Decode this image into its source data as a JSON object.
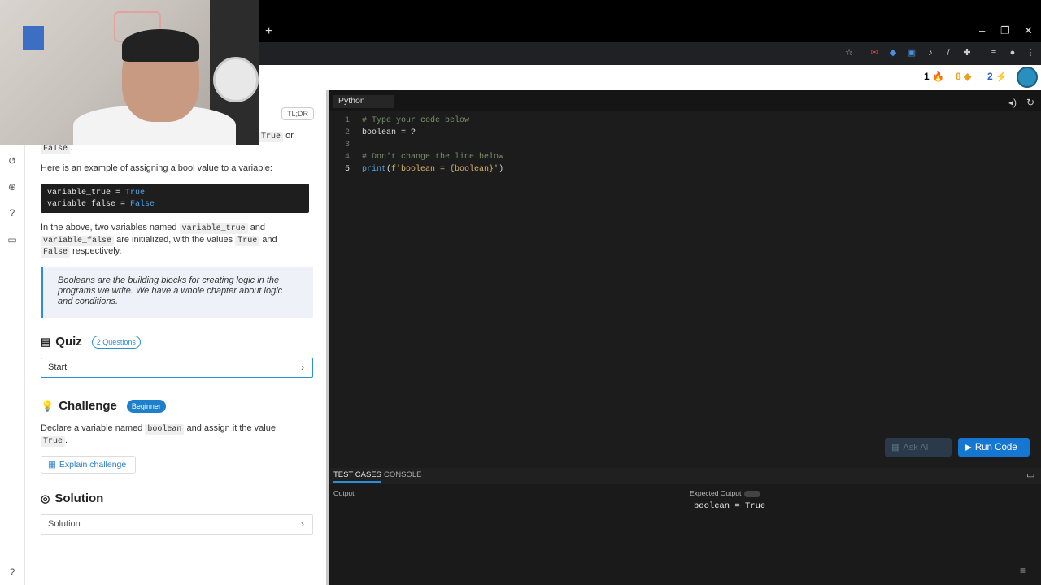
{
  "browser": {
    "new_tab": "+",
    "window_controls": [
      "–",
      "❐",
      "✕"
    ],
    "extension_icons": [
      "star-icon",
      "gmail-icon",
      "extension-icon",
      "extension-icon",
      "volume-icon",
      "extension-icon",
      "puzzle-icon",
      "media-icon",
      "profile-icon",
      "menu-icon"
    ]
  },
  "header": {
    "stats": [
      {
        "value": "1",
        "icon": "flame-icon",
        "color": "#e05a2a"
      },
      {
        "value": "8",
        "icon": "gem-icon",
        "color": "#e9a21a"
      },
      {
        "value": "2",
        "icon": "bolt-icon",
        "color": "#2a5fd6"
      }
    ]
  },
  "lesson": {
    "tldr": "TL;DR",
    "intro_true": "True",
    "intro_or": "or",
    "intro_false": "False",
    "example_text": "Here is an example of assigning a bool value to a variable:",
    "code_lines": [
      {
        "name": "variable_true",
        "op": " = ",
        "value": "True"
      },
      {
        "name": "variable_false",
        "op": " = ",
        "value": "False"
      }
    ],
    "para1_a": "In the above, two variables named",
    "para1_var1": "variable_true",
    "para1_and": "and",
    "para1_var2": "variable_false",
    "para1_b": "are initialized, with the values",
    "para1_true": "True",
    "para1_and2": "and",
    "para1_false": "False",
    "para1_c": "respectively.",
    "quote": "Booleans are the building blocks for creating logic in the programs we write. We have a whole chapter about logic and conditions.",
    "quiz": {
      "title": "Quiz",
      "badge": "2 Questions",
      "start": "Start"
    },
    "challenge": {
      "title": "Challenge",
      "badge": "Beginner",
      "text_a": "Declare a variable named",
      "var": "boolean",
      "text_b": "and assign it the value",
      "value": "True",
      "text_end": ".",
      "explain": "Explain challenge"
    },
    "solution": {
      "title": "Solution",
      "button": "Solution"
    }
  },
  "editor": {
    "language": "Python",
    "lines": [
      {
        "n": "1",
        "text": "# Type your code below"
      },
      {
        "n": "2",
        "text": "boolean = ?"
      },
      {
        "n": "3",
        "text": ""
      },
      {
        "n": "4",
        "text": "# Don't change the line below"
      },
      {
        "n": "5",
        "fn": "print",
        "paren": "(",
        "str": "f'boolean = {boolean}'",
        "close": ")"
      }
    ],
    "ask_ai": "Ask AI",
    "run": "Run Code"
  },
  "bottom": {
    "tabs": [
      "TEST CASES",
      "CONSOLE"
    ],
    "output_label": "Output",
    "expected_label": "Expected Output",
    "expected_value": "boolean = True"
  }
}
